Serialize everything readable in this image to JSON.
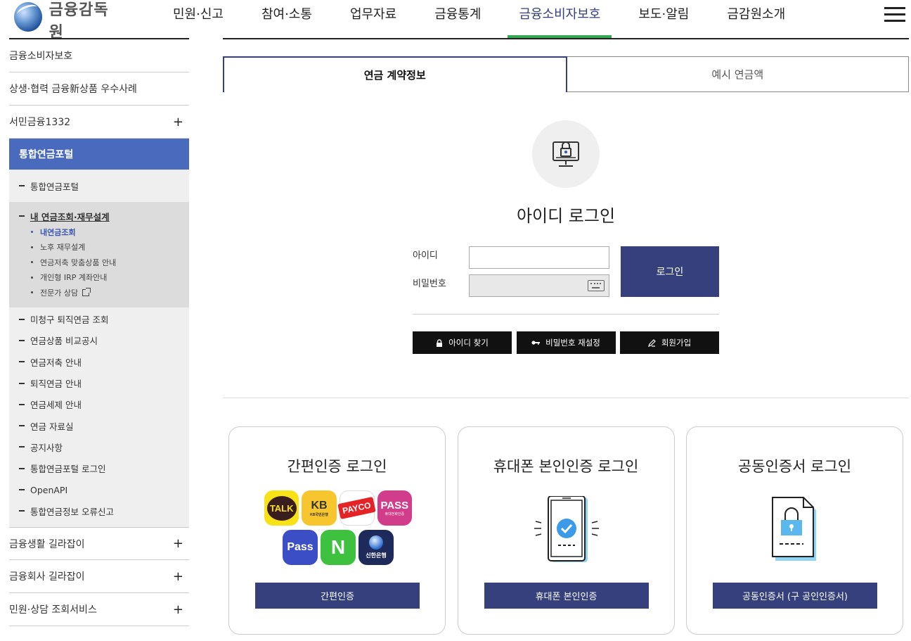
{
  "header": {
    "logo_text": "금융감독원",
    "nav": [
      "민원·신고",
      "참여·소통",
      "업무자료",
      "금융통계",
      "금융소비자보호",
      "보도·알림",
      "금감원소개"
    ],
    "active_nav": "금융소비자보호"
  },
  "sidebar": {
    "top_items": [
      {
        "label": "금융소비자보호",
        "expandable": false
      },
      {
        "label": "상생·협력 금융新상품 우수사례",
        "expandable": false
      },
      {
        "label": "서민금융1332",
        "expandable": true
      }
    ],
    "active_section": "통합연금포털",
    "sub_first": "통합연금포털",
    "current_group": {
      "label": "내 연금조회·재무설계",
      "children": [
        "내연금조회",
        "노후 재무설계",
        "연금저축 맞춤상품 안내",
        "개인형 IRP 계좌안내",
        "전문가 상담"
      ]
    },
    "sub_rest": [
      "미청구 퇴직연금 조회",
      "연금상품 비교공시",
      "연금저축 안내",
      "퇴직연금 안내",
      "연금세제 안내",
      "연금 자료실",
      "공지사항",
      "통합연금포털 로그인",
      "OpenAPI",
      "통합연금정보 오류신고"
    ],
    "bottom_items": [
      {
        "label": "금융생활 길라잡이",
        "expandable": true
      },
      {
        "label": "금융회사 길라잡이",
        "expandable": true
      },
      {
        "label": "민원·상담 조회서비스",
        "expandable": true
      }
    ],
    "plus_symbol": "+"
  },
  "tabs": [
    {
      "label": "연금 계약정보",
      "active": true
    },
    {
      "label": "예시 연금액",
      "active": false
    }
  ],
  "login": {
    "title": "아이디 로그인",
    "id_label": "아이디",
    "pw_label": "비밀번호",
    "id_value": "",
    "pw_value": "",
    "submit_label": "로그인",
    "actions": [
      {
        "label": "아이디 찾기",
        "icon": "lock-icon"
      },
      {
        "label": "비밀번호 재설정",
        "icon": "key-icon"
      },
      {
        "label": "회원가입",
        "icon": "pen-icon"
      }
    ]
  },
  "cards": [
    {
      "title": "간편인증 로그인",
      "button": "간편인증",
      "icon": "simple-auth-apps"
    },
    {
      "title": "휴대폰 본인인증 로그인",
      "button": "휴대폰 본인인증",
      "icon": "phone-check-icon"
    },
    {
      "title": "공동인증서 로그인",
      "button": "공동인증서 (구 공인인증서)",
      "icon": "certificate-lock-icon"
    }
  ],
  "apps": [
    {
      "name": "kakao-talk",
      "text": "TALK",
      "color": "#f7e117"
    },
    {
      "name": "kb",
      "text": "KB",
      "sub": "KB국민은행",
      "color": "#f7c52e"
    },
    {
      "name": "payco",
      "text": "PAYCO",
      "color": "#e52326"
    },
    {
      "name": "pass",
      "text": "PASS",
      "sub": "휴대전화인증",
      "color": "#d13c8b"
    },
    {
      "name": "pass-blue",
      "text": "Pass",
      "color": "#3b4ec6"
    },
    {
      "name": "naver",
      "text": "N",
      "color": "#3ec13e"
    },
    {
      "name": "shinhan",
      "text": "신한은행",
      "color": "#1e2a5a"
    }
  ],
  "colors": {
    "primary": "#35407d",
    "sidebar_active": "#4a6bbd",
    "nav_underline": "#34a853"
  }
}
